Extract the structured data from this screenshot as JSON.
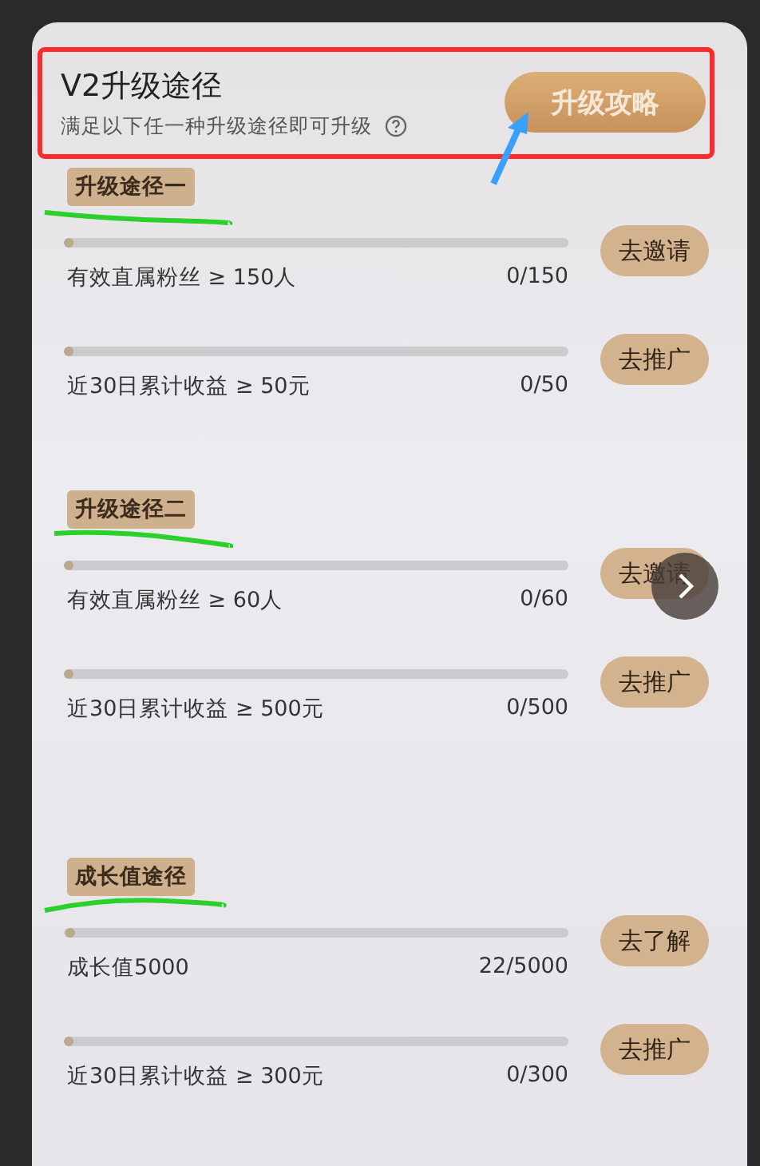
{
  "header": {
    "title": "V2升级途径",
    "subtitle": "满足以下任一种升级途径即可升级",
    "button": "升级攻略"
  },
  "sections": [
    {
      "tag": "升级途径一",
      "rows": [
        {
          "label": "有效直属粉丝 ≥ 150人",
          "reading": "0/150",
          "level": 0,
          "action": "去邀请"
        },
        {
          "label": "近30日累计收益 ≥ 50元",
          "reading": "0/50",
          "level": 0,
          "action": "去推广"
        }
      ]
    },
    {
      "tag": "升级途径二",
      "rows": [
        {
          "label": "有效直属粉丝 ≥ 60人",
          "reading": "0/60",
          "level": 0,
          "action": "去邀请"
        },
        {
          "label": "近30日累计收益 ≥ 500元",
          "reading": "0/500",
          "level": 0,
          "action": "去推广"
        }
      ]
    },
    {
      "tag": "成长值途径",
      "rows": [
        {
          "label": "成长值5000",
          "reading": "22/5000",
          "level": 0.0044,
          "action": "去了解"
        },
        {
          "label": "近30日累计收益 ≥ 300元",
          "reading": "0/300",
          "level": 0,
          "action": "去推广"
        }
      ]
    }
  ]
}
